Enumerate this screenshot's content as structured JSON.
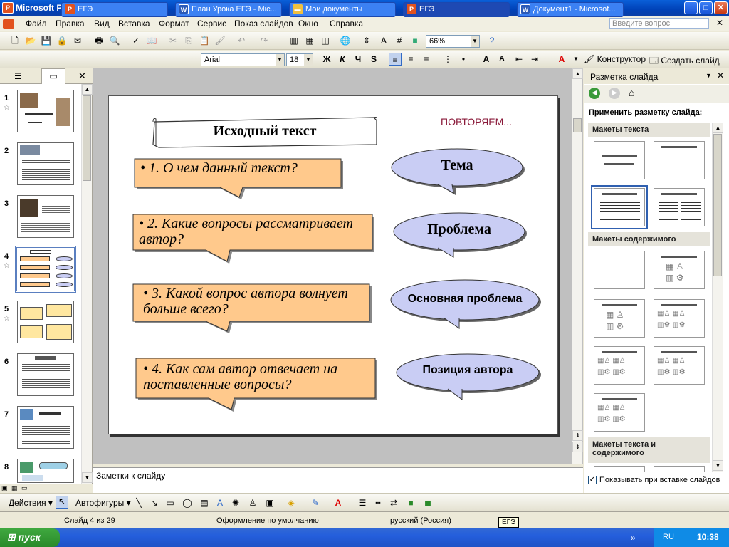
{
  "window": {
    "title": "Microsoft PowerPoint - [ЕГЭ]",
    "app_icon_label": "P",
    "minimize": "_",
    "maximize": "□",
    "close": "✕"
  },
  "menu": {
    "items": [
      "Файл",
      "Правка",
      "Вид",
      "Вставка",
      "Формат",
      "Сервис",
      "Показ слайдов",
      "Окно",
      "Справка"
    ],
    "help_placeholder": "Введите вопрос",
    "close_doc": "✕"
  },
  "toolbar": {
    "zoom": "66%",
    "font_name": "Arial",
    "font_size": "18",
    "bold": "Ж",
    "italic": "К",
    "underline": "Ч",
    "shadow": "S",
    "designer": "Конструктор",
    "new_slide": "Создать слайд"
  },
  "thumbnails": {
    "numbers": [
      "1",
      "2",
      "3",
      "4",
      "5",
      "6",
      "7",
      "8"
    ],
    "selected": "4"
  },
  "slide": {
    "title": "Исходный текст",
    "repeat_label": "ПОВТОРЯЕМ...",
    "questions": [
      "• 1. О чем данный текст?",
      "• 2. Какие вопросы рассматривает автор?",
      "• 3. Какой вопрос автора волнует больше всего?",
      "• 4. Как сам автор отвечает на поставленные вопросы?"
    ],
    "answers": [
      "Тема",
      "Проблема",
      "Основная проблема",
      "Позиция автора"
    ],
    "colors": {
      "question_fill": "#ffc98c",
      "answer_fill": "#c9cdf4",
      "repeat_color": "#8a1a3a"
    }
  },
  "notes": {
    "placeholder": "Заметки к слайду"
  },
  "taskpane": {
    "title": "Разметка слайда",
    "apply_label": "Применить разметку слайда:",
    "group_text": "Макеты текста",
    "group_content": "Макеты содержимого",
    "group_text_content": "Макеты текста и содержимого",
    "show_on_insert": "Показывать при вставке слайдов",
    "show_on_insert_checked": true
  },
  "drawbar": {
    "actions": "Действия",
    "autoshapes": "Автофигуры"
  },
  "status": {
    "slide": "Слайд 4 из 29",
    "design": "Оформление по умолчанию",
    "language": "русский (Россия)"
  },
  "tooltip": "ЕГЭ",
  "taskbar": {
    "start": "пуск",
    "items": [
      "ЕГЭ",
      "План Урока ЕГЭ - Mic...",
      "Мои документы",
      "ЕГЭ",
      "Документ1 - Microsof..."
    ],
    "lang": "RU",
    "clock": "10:38"
  }
}
